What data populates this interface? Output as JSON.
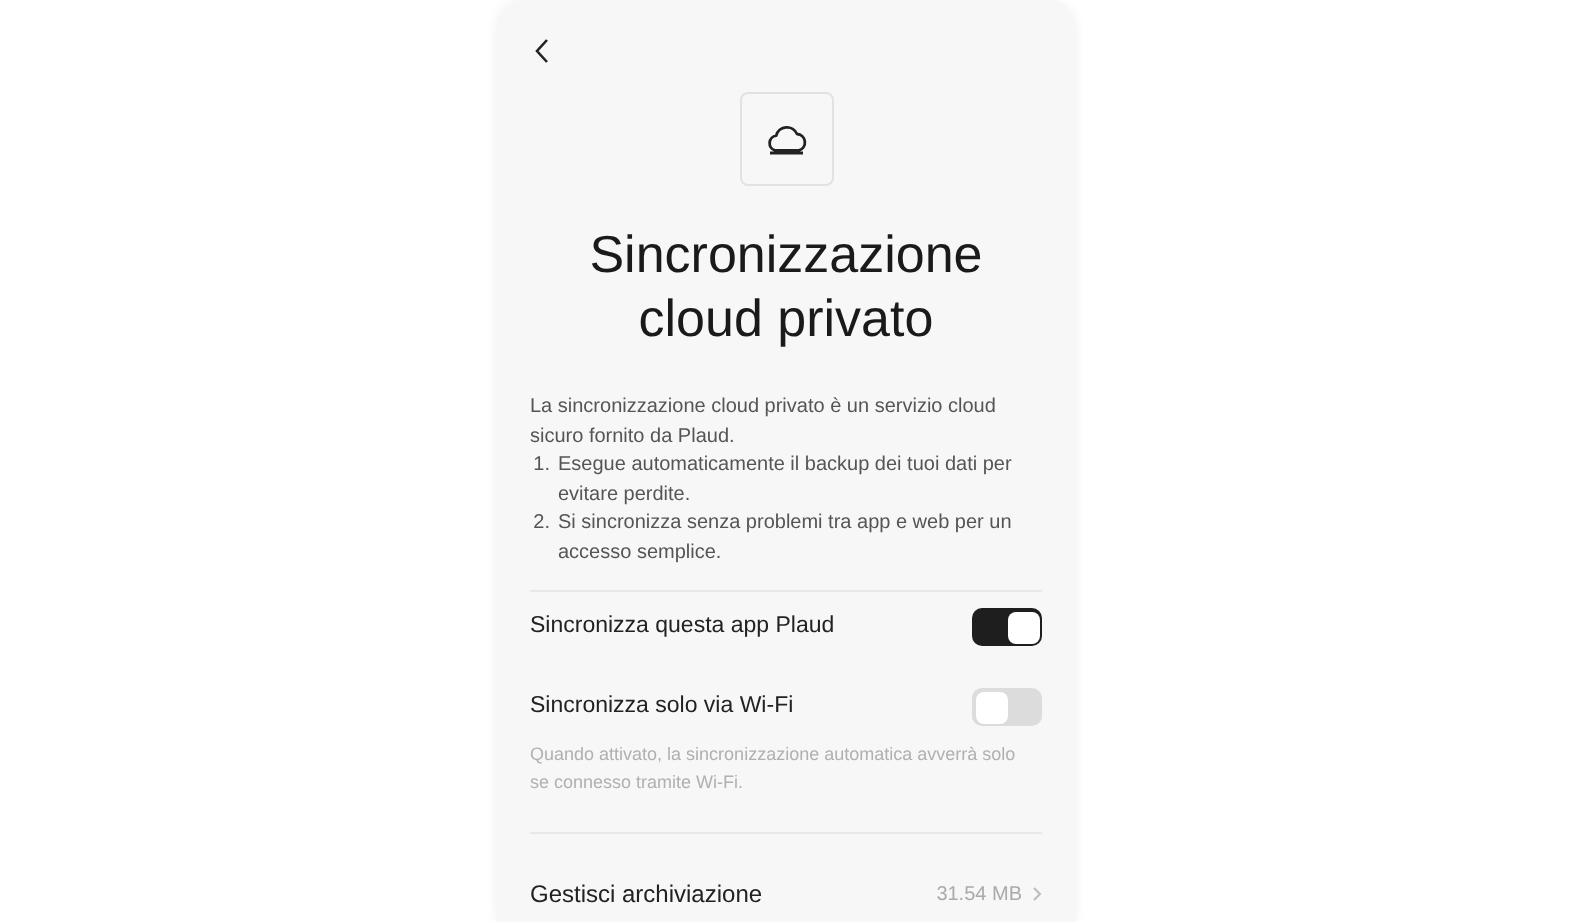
{
  "title": "Sincronizzazione cloud privato",
  "description": "La sincronizzazione cloud privato è un servizio cloud sicuro fornito da Plaud.",
  "features": [
    {
      "number": "1.",
      "text": "Esegue automaticamente il backup dei tuoi dati per evitare perdite."
    },
    {
      "number": "2.",
      "text": "Si sincronizza senza problemi tra app e web per un accesso semplice."
    }
  ],
  "settings": [
    {
      "label": "Sincronizza questa app Plaud",
      "on": true
    },
    {
      "label": "Sincronizza solo via Wi-Fi",
      "on": false,
      "hint": "Quando attivato, la sincronizzazione automatica avverrà solo se connesso tramite Wi-Fi."
    }
  ],
  "storage": {
    "label": "Gestisci archiviazione",
    "value": "31.54 MB"
  }
}
